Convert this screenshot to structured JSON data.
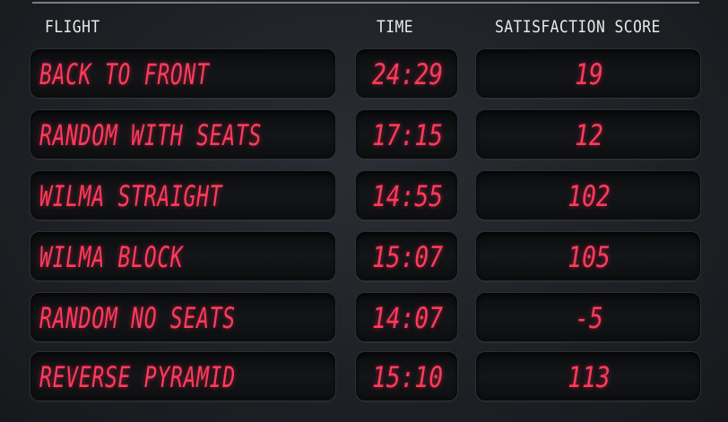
{
  "headers": {
    "flight": "FLIGHT",
    "time": "TIME",
    "score": "SATISFACTION SCORE"
  },
  "rows": [
    {
      "flight": "BACK TO FRONT",
      "time": "24:29",
      "score": "19"
    },
    {
      "flight": "RANDOM WITH SEATS",
      "time": "17:15",
      "score": "12"
    },
    {
      "flight": "WILMA STRAIGHT",
      "time": "14:55",
      "score": "102"
    },
    {
      "flight": "WILMA BLOCK",
      "time": "15:07",
      "score": "105"
    },
    {
      "flight": "RANDOM NO SEATS",
      "time": "14:07",
      "score": "-5"
    },
    {
      "flight": "REVERSE PYRAMID",
      "time": "15:10",
      "score": "113"
    }
  ],
  "colors": {
    "segment_text": "#ff3b5c",
    "header_text": "#e8e8ea",
    "background": "#1f2126"
  }
}
